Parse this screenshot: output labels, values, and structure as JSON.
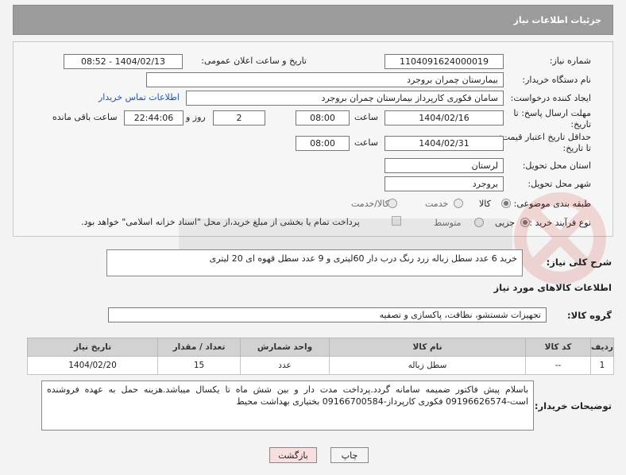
{
  "header": {
    "title": "جزئیات اطلاعات نیاز"
  },
  "form": {
    "need_number_label": "شماره نیاز:",
    "need_number": "1104091624000019",
    "announce_label": "تاریخ و ساعت اعلان عمومی:",
    "announce_value": "1404/02/13 - 08:52",
    "buyer_org_label": "نام دستگاه خریدار:",
    "buyer_org": "بیمارستان چمران بروجرد",
    "requester_label": "ایجاد کننده درخواست:",
    "requester": "سامان فکوری کارپرداز بیمارستان چمران بروجرد",
    "contact_link": "اطلاعات تماس خریدار",
    "reply_deadline_label": "مهلت ارسال پاسخ: تا تاریخ:",
    "reply_date": "1404/02/16",
    "time_label": "ساعت",
    "reply_time": "08:00",
    "days_value": "2",
    "days_label": "روز و",
    "remaining_time": "22:44:06",
    "remaining_label": "ساعت باقی مانده",
    "price_deadline_label": "حداقل تاریخ اعتبار قیمت: تا تاریخ:",
    "price_date": "1404/02/31",
    "price_time": "08:00",
    "province_label": "استان محل تحویل:",
    "province": "لرستان",
    "city_label": "شهر محل تحویل:",
    "city": "بروجرد",
    "category_label": "طبقه بندی موضوعی:",
    "category_options": [
      "کالا",
      "خدمت",
      "کالا/خدمت"
    ],
    "process_label": "نوع فرآیند خرید :",
    "process_options": [
      "جزیی",
      "متوسط"
    ],
    "payment_note": "پرداخت تمام یا بخشی از مبلغ خرید،از محل \"اسناد خزانه اسلامی\" خواهد بود."
  },
  "description": {
    "label": "شرح کلی نیاز:",
    "text": "خرید 6 عدد سطل زباله زرد رنگ درب دار 60لیتری  و 9 عدد سطل قهوه ای 20 لیتری"
  },
  "goods": {
    "section_title": "اطلاعات کالاهای مورد نیاز",
    "group_label": "گروه کالا:",
    "group_value": "تجهیزات شستشو، نظافت، پاکسازی و تصفیه",
    "columns": [
      "ردیف",
      "کد کالا",
      "نام کالا",
      "واحد شمارش",
      "تعداد / مقدار",
      "تاریخ نیاز"
    ],
    "rows": [
      {
        "row": "1",
        "code": "--",
        "name": "سطل زباله",
        "unit": "عدد",
        "qty": "15",
        "date": "1404/02/20"
      }
    ]
  },
  "buyer_notes": {
    "label": "توضیحات خریدار:",
    "text": "باسلام پیش فاکتور ضمیمه سامانه گردد.پرداخت مدت دار و بین شش ماه تا یکسال میباشد.هزینه حمل به عهده فروشنده است-09196626574 فکوری کارپرداز-09166700584 بختیاری بهداشت محیط"
  },
  "buttons": {
    "print": "چاپ",
    "back": "بازگشت"
  },
  "colors": {
    "header_bg": "#9b9b9b",
    "link": "#1a56b4",
    "back_button_bg": "#f8dede"
  }
}
